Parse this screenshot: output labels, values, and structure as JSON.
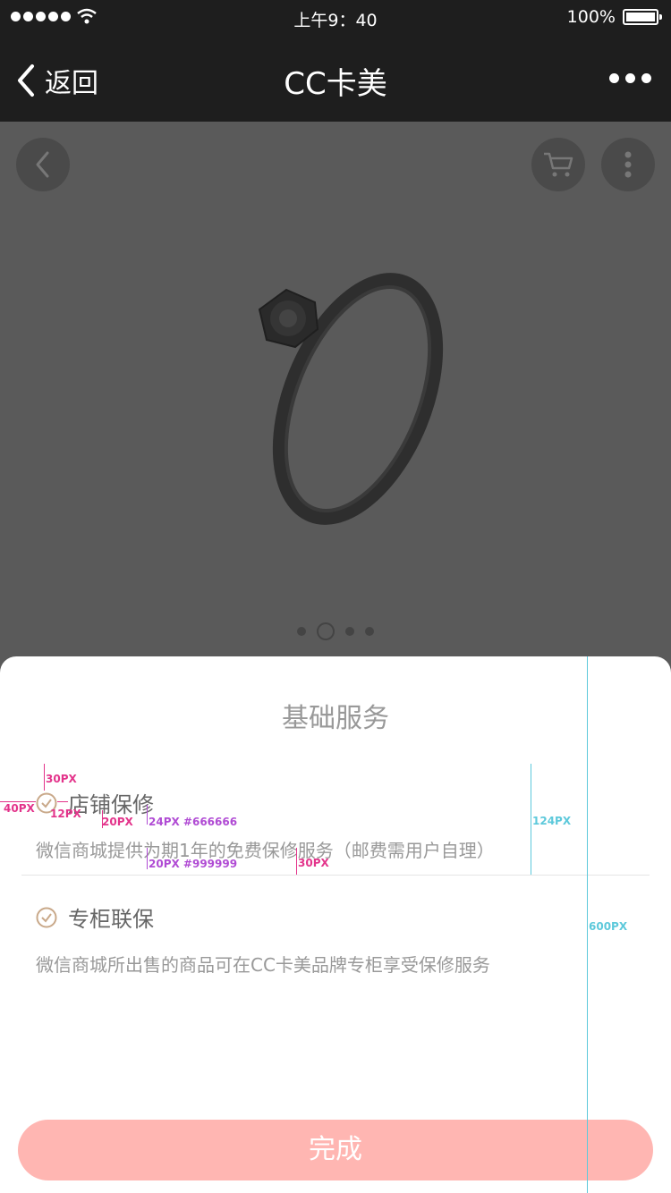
{
  "status_bar": {
    "time": "上午9：40",
    "battery": "100%"
  },
  "nav_bar": {
    "back_label": "返回",
    "title": "CC卡美"
  },
  "hero": {
    "dots": 4,
    "active_dot": 1
  },
  "sheet": {
    "title": "基础服务",
    "services": [
      {
        "name": "店铺保修",
        "desc": "微信商城提供为期1年的免费保修服务（邮费需用户自理）"
      },
      {
        "name": "专柜联保",
        "desc": "微信商城所出售的商品可在CC卡美品牌专柜享受保修服务"
      }
    ],
    "done_label": "完成"
  },
  "annotations": {
    "a30top": "30PX",
    "a40": "40PX",
    "a12": "12PX",
    "a20": "20PX",
    "a24": "24PX #666666",
    "a20gray": "20PX #999999",
    "a30bot": "30PX",
    "a124": "124PX",
    "a600": "600PX"
  },
  "colors": {
    "accent": "#ffb6b2",
    "check": "#c9a98a",
    "annotation_pink": "#e3348b",
    "annotation_purple": "#b04bd4",
    "annotation_cyan": "#5dc9db"
  }
}
